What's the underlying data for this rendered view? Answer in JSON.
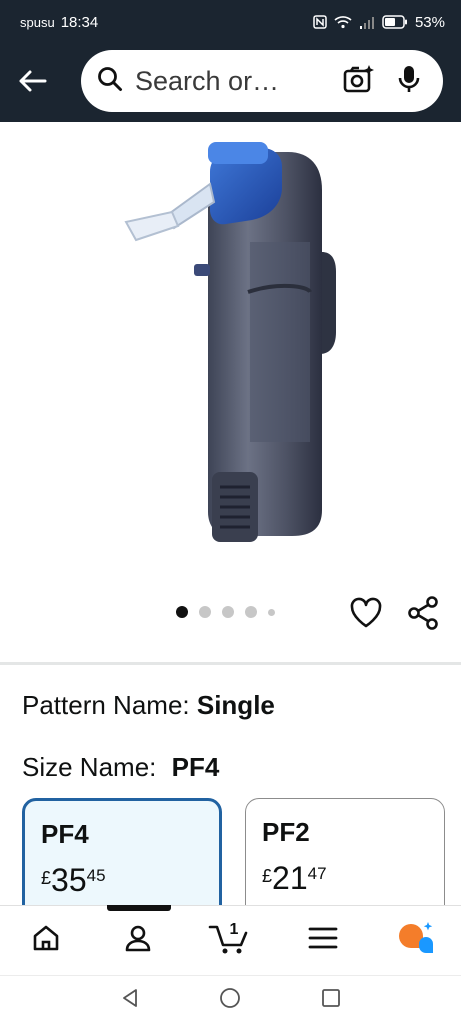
{
  "status_bar": {
    "carrier": "spusu",
    "time": "18:34",
    "battery": "53%"
  },
  "header": {
    "search_placeholder": "Search or…"
  },
  "product": {
    "image_dots": {
      "count": 5,
      "active_index": 0
    }
  },
  "variation": {
    "pattern_label": "Pattern Name: ",
    "pattern_value": "Single",
    "size_label": "Size Name: ",
    "size_value": "PF4",
    "options": [
      {
        "name": "PF4",
        "currency": "£",
        "whole": "35",
        "fraction": "45",
        "selected": true
      },
      {
        "name": "PF2",
        "currency": "£",
        "whole": "21",
        "fraction": "47",
        "selected": false
      }
    ]
  },
  "bottom_nav": {
    "cart_count": "1",
    "items": [
      "home",
      "account",
      "cart",
      "menu",
      "rufus"
    ]
  },
  "colors": {
    "header_bg": "#1b2530",
    "selected_border": "#2162a1",
    "selected_bg": "#edf8fd",
    "rufus_orange": "#f47d2a",
    "rufus_blue": "#1a98ff"
  }
}
